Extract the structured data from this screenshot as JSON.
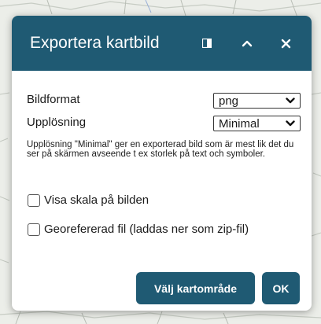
{
  "dialog": {
    "title": "Exportera kartbild"
  },
  "header_icons": {
    "dock": "dock-panel-icon",
    "collapse": "chevron-up-icon",
    "close": "close-icon"
  },
  "form": {
    "format_label": "Bildformat",
    "format_value": "png",
    "resolution_label": "Upplösning",
    "resolution_value": "Minimal",
    "help_text": "Upplösning \"Minimal\" ger en exporterad bild som är mest lik det du ser på skärmen avseende t ex storlek på text och symboler.",
    "show_scale_label": "Visa skala på bilden",
    "show_scale_checked": false,
    "georef_label": "Georefererad fil (laddas ner som zip-fil)",
    "georef_checked": false
  },
  "actions": {
    "select_area_label": "Välj kartområde",
    "ok_label": "OK"
  },
  "colors": {
    "accent": "#1f5a73",
    "map_background": "#e9ebe6"
  }
}
